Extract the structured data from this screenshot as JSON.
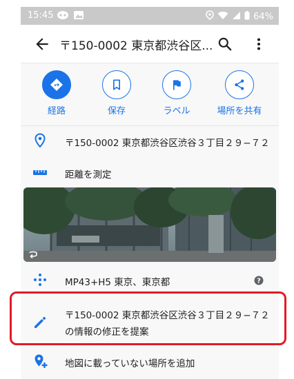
{
  "status_bar": {
    "time": "15:45",
    "battery": "64%"
  },
  "app_bar": {
    "title": "〒150-0002 東京都渋谷区..."
  },
  "actions": [
    {
      "label": "経路",
      "icon": "directions-icon"
    },
    {
      "label": "保存",
      "icon": "bookmark-icon"
    },
    {
      "label": "ラベル",
      "icon": "flag-icon"
    },
    {
      "label": "場所を共有",
      "icon": "share-icon"
    }
  ],
  "rows": {
    "address": "〒150-0002 東京都渋谷区渋谷３丁目２９−７２",
    "measure": "距離を測定",
    "plus_code": "MP43+H5 東京、東京都",
    "suggest_edit_line1": "〒150-0002 東京都渋谷区渋谷３丁目２９−７２",
    "suggest_edit_line2": "の情報の修正を提案",
    "add_place": "地図に載っていない場所を追加"
  },
  "colors": {
    "accent": "#1a73e8",
    "highlight": "#e01b24",
    "status_bar": "#c9c9c9"
  }
}
